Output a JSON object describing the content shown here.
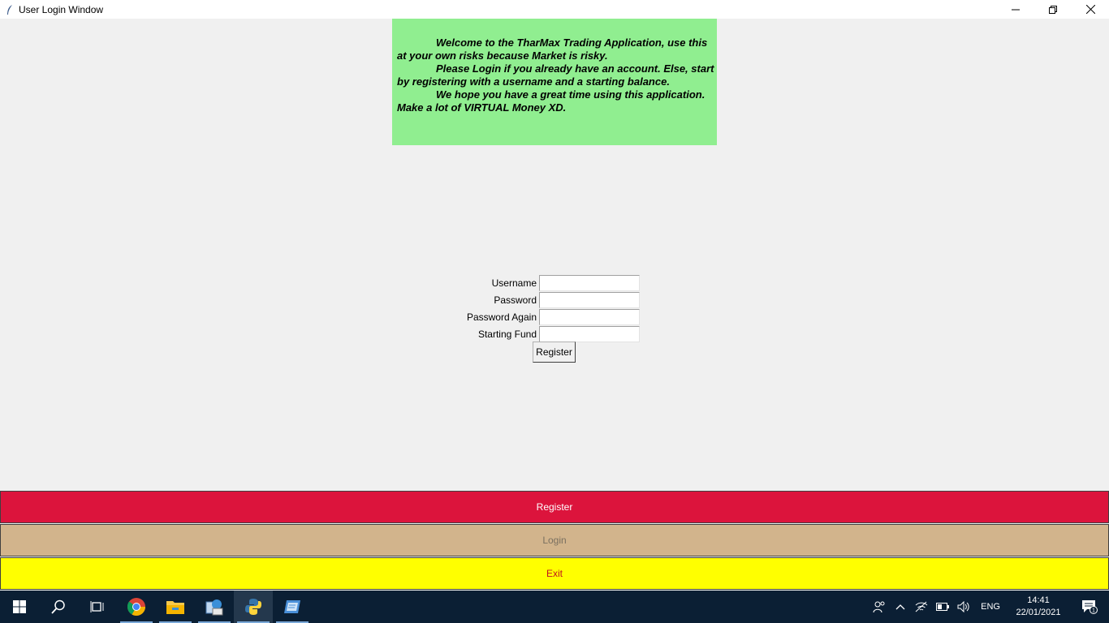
{
  "window": {
    "title": "User Login Window",
    "icon": "feather-icon",
    "controls": [
      "minimize-icon",
      "restore-icon",
      "close-icon"
    ]
  },
  "welcome": {
    "lines": [
      "Welcome to the TharMax Trading Application, use this",
      "at your own risks because Market is risky.",
      "Please Login if you already have an account. Else, start",
      "by registering with a username and a starting balance.",
      "We hope you have a great time using this application.",
      "Make a lot of VIRTUAL Money XD."
    ],
    "background": "#90ee90"
  },
  "form": {
    "username_label": "Username",
    "username_value": "",
    "password_label": "Password",
    "password_value": "",
    "password_again_label": "Password Again",
    "password_again_value": "",
    "starting_fund_label": "Starting Fund",
    "starting_fund_value": "",
    "register_button": "Register"
  },
  "bottom_bar": {
    "register": "Register",
    "login": "Login",
    "exit": "Exit",
    "colors": {
      "register": "#dc143c",
      "login": "#d2b48c",
      "exit": "#ffff00"
    }
  },
  "taskbar": {
    "apps": [
      "windows-start-icon",
      "search-icon",
      "task-view-icon",
      "chrome-icon",
      "file-explorer-icon",
      "network-app-icon",
      "python-icon",
      "remote-app-icon"
    ],
    "tray": {
      "language": "ENG",
      "time": "14:41",
      "date": "22/01/2021",
      "notification_count": "1"
    }
  }
}
